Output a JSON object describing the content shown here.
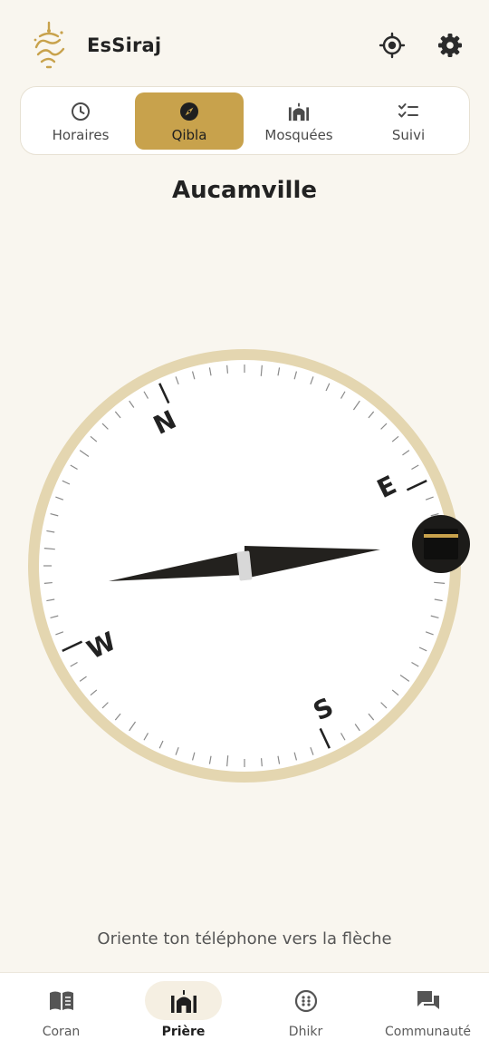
{
  "header": {
    "app_name": "EsSiraj",
    "logo_icon": "essiraj-calligraphy-logo",
    "location_button_icon": "gps-target-icon",
    "settings_button_icon": "gear-icon"
  },
  "tabs": [
    {
      "label": "Horaires",
      "icon": "clock-icon",
      "active": false
    },
    {
      "label": "Qibla",
      "icon": "compass-icon",
      "active": true
    },
    {
      "label": "Mosquées",
      "icon": "mosque-icon",
      "active": false
    },
    {
      "label": "Suivi",
      "icon": "checklist-icon",
      "active": false
    }
  ],
  "qibla": {
    "city": "Aucamville",
    "compass_labels": {
      "north": "N",
      "east": "E",
      "south": "S",
      "west": "W"
    },
    "qibla_marker_icon": "kaaba-icon",
    "hint": "Oriente ton téléphone vers la flèche"
  },
  "bottom_nav": [
    {
      "label": "Coran",
      "icon": "book-icon",
      "active": false
    },
    {
      "label": "Prière",
      "icon": "mosque-icon",
      "active": true
    },
    {
      "label": "Dhikr",
      "icon": "prayer-beads-icon",
      "active": false
    },
    {
      "label": "Communauté",
      "icon": "chat-bubbles-icon",
      "active": false
    }
  ],
  "colors": {
    "accent": "#c8a24c",
    "background": "#f9f6ef",
    "compass_ring": "#e4d6b0",
    "needle": "#23211e",
    "kaaba_badge": "#1c1b19",
    "kaaba_gold": "#c8a24c"
  }
}
